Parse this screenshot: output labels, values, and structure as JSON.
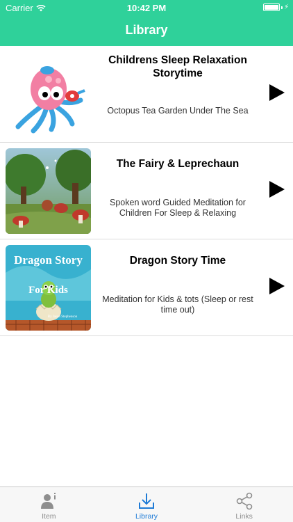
{
  "status_bar": {
    "carrier": "Carrier",
    "time": "10:42 PM"
  },
  "nav": {
    "title": "Library"
  },
  "items": [
    {
      "title": "Childrens Sleep Relaxation Storytime",
      "subtitle": "Octopus Tea Garden Under The Sea",
      "thumb": "octopus-image"
    },
    {
      "title": "The Fairy & Leprechaun",
      "subtitle": "Spoken word Guided Meditation for Children For Sleep & Relaxing",
      "thumb": "fairy-forest-image"
    },
    {
      "title": "Dragon Story Time",
      "subtitle": "Meditation for Kids & tots (Sleep or rest time out)",
      "thumb": "dragon-cover-image",
      "cover_title_line1": "Dragon Story",
      "cover_title_line2": "For Kids",
      "cover_author": "By Jason Stephenson"
    }
  ],
  "tabs": [
    {
      "label": "Item",
      "icon": "person-info-icon",
      "active": false
    },
    {
      "label": "Library",
      "icon": "download-tray-icon",
      "active": true
    },
    {
      "label": "Links",
      "icon": "share-icon",
      "active": false
    }
  ],
  "colors": {
    "header": "#2fd19a",
    "tab_active": "#1f7bd6",
    "tab_inactive": "#8e8e8e"
  }
}
